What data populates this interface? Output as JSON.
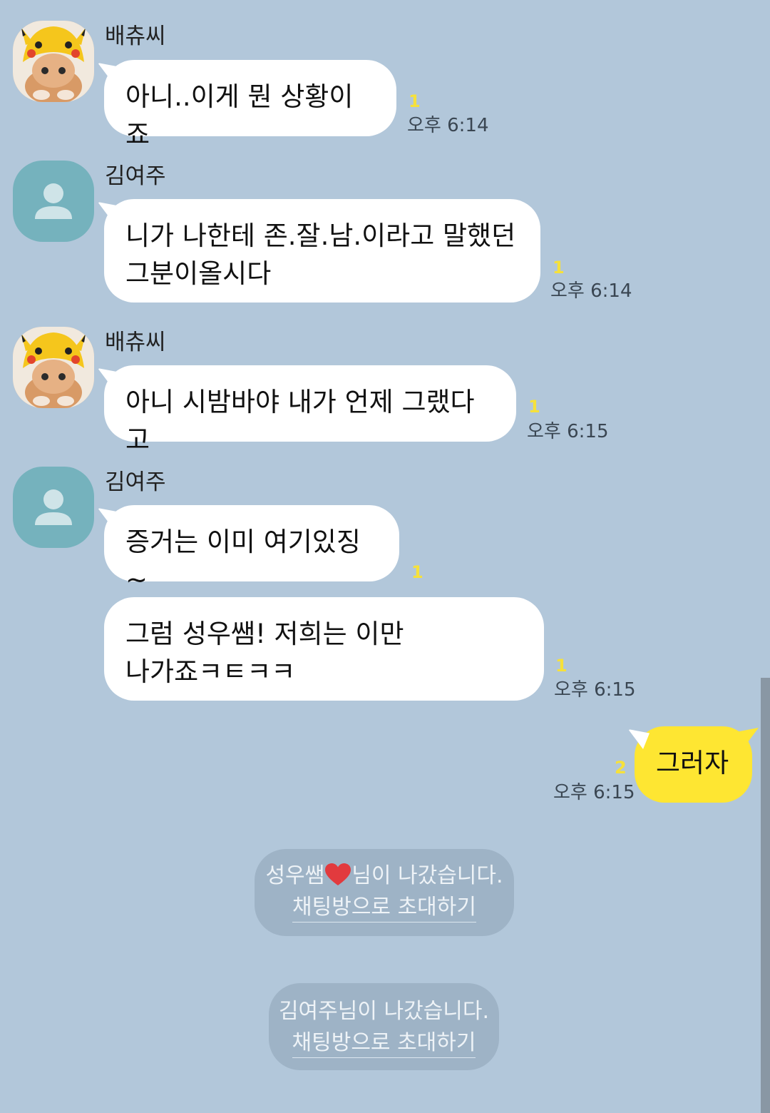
{
  "messages": [
    {
      "sender": "배츄씨",
      "text": "아니..이게 뭔 상황이죠",
      "unread": "1",
      "time": "오후 6:14"
    },
    {
      "sender": "김여주",
      "text": "니가 나한테 존.잘.남.이라고 말했던\n그분이올시다",
      "unread": "1",
      "time": "오후 6:14"
    },
    {
      "sender": "배츄씨",
      "text": "아니 시밤바야 내가 언제 그랬다고",
      "unread": "1",
      "time": "오후 6:15"
    },
    {
      "sender": "김여주",
      "text": "증거는 이미 여기있징~",
      "unread": "1",
      "time": ""
    },
    {
      "sender": "",
      "text": "그럼 성우쌤! 저희는 이만\n나가죠ㅋㅌㅋㅋ",
      "unread": "1",
      "time": "오후 6:15"
    },
    {
      "sender": "me",
      "text": "그러자",
      "unread": "2",
      "time": "오후 6:15"
    }
  ],
  "notices": [
    {
      "text_before": "성우쌤",
      "text_after": "님이 나갔습니다.",
      "link": "채팅방으로 초대하기"
    },
    {
      "text": "김여주님이 나갔습니다.",
      "link": "채팅방으로 초대하기"
    }
  ],
  "icons": {
    "profile_cat": "pikachu-hat-cat-photo",
    "profile_default": "default-person-icon",
    "heart": "red-heart-emoji"
  },
  "colors": {
    "background": "#b2c7da",
    "my_bubble": "#fee632",
    "unread": "#f6e13b",
    "notice": "#9eb3c6"
  }
}
